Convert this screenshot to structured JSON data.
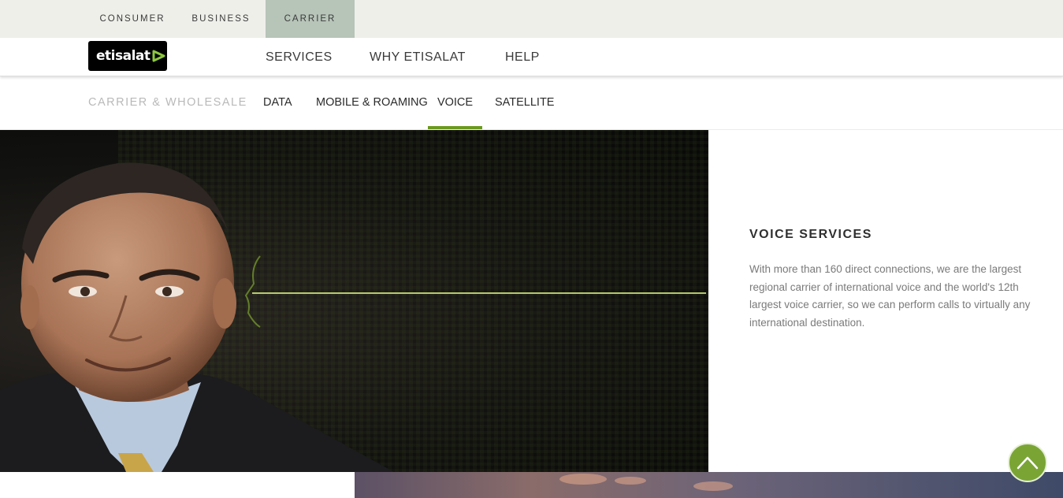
{
  "segments": {
    "consumer": "CONSUMER",
    "business": "BUSINESS",
    "carrier": "CARRIER",
    "active": "carrier"
  },
  "header": {
    "logo_text": "etisalat",
    "nav": {
      "services": "SERVICES",
      "why": "WHY ETISALAT",
      "help": "HELP"
    }
  },
  "subnav": {
    "title": "CARRIER & WHOLESALE",
    "items": {
      "data": "DATA",
      "mobile": "MOBILE & ROAMING",
      "voice": "VOICE",
      "satellite": "SATELLITE"
    },
    "active": "voice"
  },
  "hero": {
    "heading": "VOICE SERVICES",
    "body": "With more than 160 direct connections, we are the largest regional carrier of international voice and the world's 12th largest voice carrier, so we can perform calls to virtually any international destination."
  },
  "colors": {
    "brand_green": "#6b9a1e",
    "scroll_button": "#7aa535",
    "segment_active": "#b7c4b8",
    "segment_bar": "#efefea"
  },
  "icons": {
    "scroll_top": "chevron-up-icon",
    "logo_mark": "etisalat-mark-icon"
  }
}
